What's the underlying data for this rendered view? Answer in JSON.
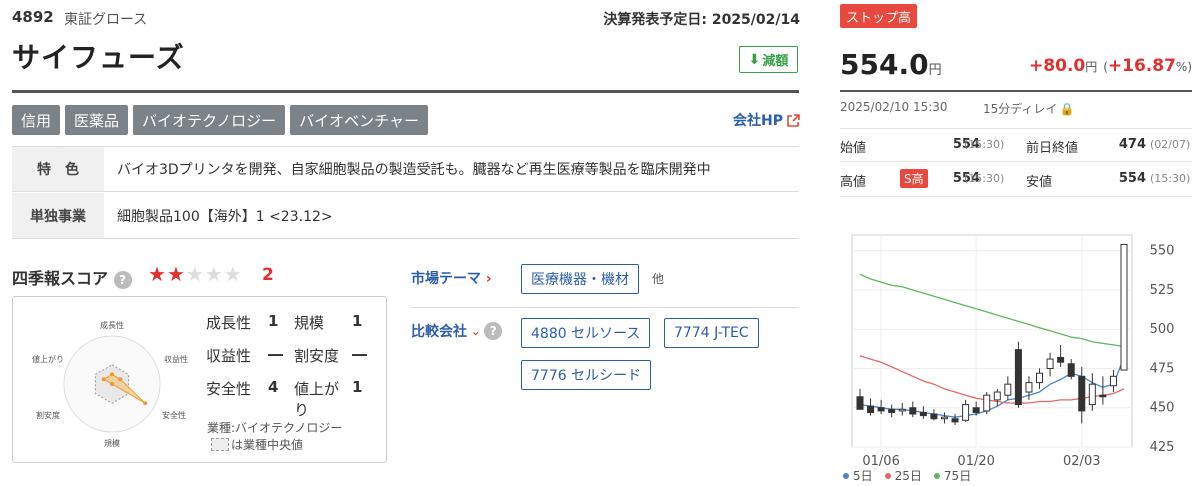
{
  "header": {
    "code": "4892",
    "market": "東証グロース",
    "earnings_date": "決算発表予定日: 2025/02/14",
    "company_name": "サイフューズ",
    "dividend_badge": "減額"
  },
  "tags": [
    "信用",
    "医薬品",
    "バイオテクノロジー",
    "バイオベンチャー"
  ],
  "company_hp": "会社HP",
  "info": [
    {
      "label": "特　色",
      "value": "バイオ3Dプリンタを開発、自家細胞製品の製造受託も。臓器など再生医療等製品を臨床開発中"
    },
    {
      "label": "単独事業",
      "value": "細胞製品100【海外】1 <23.12>"
    }
  ],
  "score": {
    "title": "四季報スコア",
    "star_value": "2",
    "stars_filled": 2,
    "stars_total": 5,
    "radar_labels": [
      "成長性",
      "収益性",
      "安全性",
      "規模",
      "割安度",
      "値上がり"
    ],
    "radar_values": [
      1,
      1,
      4,
      0,
      0,
      1
    ],
    "items": [
      {
        "label": "成長性",
        "value": "1"
      },
      {
        "label": "規模",
        "value": "1"
      },
      {
        "label": "収益性",
        "value": "―"
      },
      {
        "label": "割安度",
        "value": "―"
      },
      {
        "label": "安全性",
        "value": "4"
      },
      {
        "label": "値上がり",
        "value": "1"
      }
    ],
    "industry": "業種:バイオテクノロジー",
    "median_note": "は業種中央値"
  },
  "market_theme": {
    "label": "市場テーマ",
    "tag": "医療機器・機材",
    "other": "他"
  },
  "compare": {
    "label": "比較会社",
    "companies": [
      "4880 セルソース",
      "7774 J-TEC",
      "7776 セルシード"
    ]
  },
  "quote": {
    "status_badge": "ストップ高",
    "price": "554.0",
    "price_unit": "円",
    "change": "+80.0",
    "change_unit": "円",
    "change_pct": "+16.87",
    "pct_unit": "%",
    "datetime": "2025/02/10 15:30",
    "delay": "15分ディレイ",
    "rows": [
      {
        "label": "始値",
        "value": "554",
        "time": "(15:30)",
        "label2": "前日終値",
        "value2": "474",
        "time2": "(02/07)"
      },
      {
        "label": "高値",
        "badge": "S高",
        "value": "554",
        "time": "(15:30)",
        "label2": "安値",
        "value2": "554",
        "time2": "(15:30)"
      }
    ]
  },
  "colors": {
    "accent_red": "#e03030",
    "link_blue": "#2c5ea8",
    "up_green": "#39a04a",
    "ma5": "#4a86c8",
    "ma25": "#e06a6a",
    "ma75": "#5cb85c"
  },
  "chart_data": {
    "type": "line",
    "x_tick_labels": [
      "01/06",
      "01/20",
      "02/03"
    ],
    "y_tick_labels": [
      "550",
      "525",
      "500",
      "475",
      "450",
      "425"
    ],
    "ylim": [
      425,
      560
    ],
    "grid": true,
    "legend_position": "bottom-left",
    "candles": [
      {
        "o": 457,
        "h": 462,
        "l": 450,
        "c": 449
      },
      {
        "o": 451,
        "h": 456,
        "l": 445,
        "c": 447
      },
      {
        "o": 450,
        "h": 455,
        "l": 446,
        "c": 448
      },
      {
        "o": 449,
        "h": 452,
        "l": 444,
        "c": 447
      },
      {
        "o": 448,
        "h": 453,
        "l": 445,
        "c": 449
      },
      {
        "o": 450,
        "h": 454,
        "l": 444,
        "c": 446
      },
      {
        "o": 447,
        "h": 451,
        "l": 443,
        "c": 445
      },
      {
        "o": 446,
        "h": 449,
        "l": 442,
        "c": 443
      },
      {
        "o": 443,
        "h": 447,
        "l": 440,
        "c": 444
      },
      {
        "o": 443,
        "h": 446,
        "l": 439,
        "c": 441
      },
      {
        "o": 442,
        "h": 455,
        "l": 441,
        "c": 452
      },
      {
        "o": 450,
        "h": 454,
        "l": 445,
        "c": 447
      },
      {
        "o": 448,
        "h": 460,
        "l": 446,
        "c": 458
      },
      {
        "o": 455,
        "h": 462,
        "l": 451,
        "c": 460
      },
      {
        "o": 458,
        "h": 470,
        "l": 455,
        "c": 465
      },
      {
        "o": 487,
        "h": 492,
        "l": 450,
        "c": 452
      },
      {
        "o": 460,
        "h": 470,
        "l": 455,
        "c": 466
      },
      {
        "o": 466,
        "h": 475,
        "l": 462,
        "c": 472
      },
      {
        "o": 475,
        "h": 485,
        "l": 470,
        "c": 481
      },
      {
        "o": 482,
        "h": 490,
        "l": 476,
        "c": 479
      },
      {
        "o": 478,
        "h": 481,
        "l": 468,
        "c": 470
      },
      {
        "o": 470,
        "h": 476,
        "l": 440,
        "c": 448
      },
      {
        "o": 452,
        "h": 472,
        "l": 448,
        "c": 465
      },
      {
        "o": 458,
        "h": 470,
        "l": 452,
        "c": 457
      },
      {
        "o": 464,
        "h": 474,
        "l": 460,
        "c": 470
      },
      {
        "o": 474,
        "h": 554,
        "l": 474,
        "c": 554
      }
    ],
    "series": [
      {
        "name": "5日",
        "values": [
          452,
          451,
          450,
          449,
          449,
          448,
          447,
          446,
          445,
          444,
          445,
          446,
          448,
          451,
          455,
          456,
          458,
          460,
          465,
          468,
          472,
          470,
          466,
          463,
          465,
          482
        ]
      },
      {
        "name": "25日",
        "values": [
          483,
          481,
          479,
          476,
          473,
          470,
          467,
          465,
          462,
          460,
          458,
          456,
          455,
          454,
          453,
          453,
          453,
          454,
          454,
          455,
          455,
          456,
          457,
          458,
          459,
          462
        ]
      },
      {
        "name": "75日",
        "values": [
          535,
          532,
          530,
          528,
          527,
          525,
          523,
          521,
          519,
          517,
          515,
          513,
          511,
          509,
          507,
          505,
          503,
          501,
          499,
          497,
          495,
          494,
          492,
          491,
          490,
          489
        ]
      }
    ]
  }
}
